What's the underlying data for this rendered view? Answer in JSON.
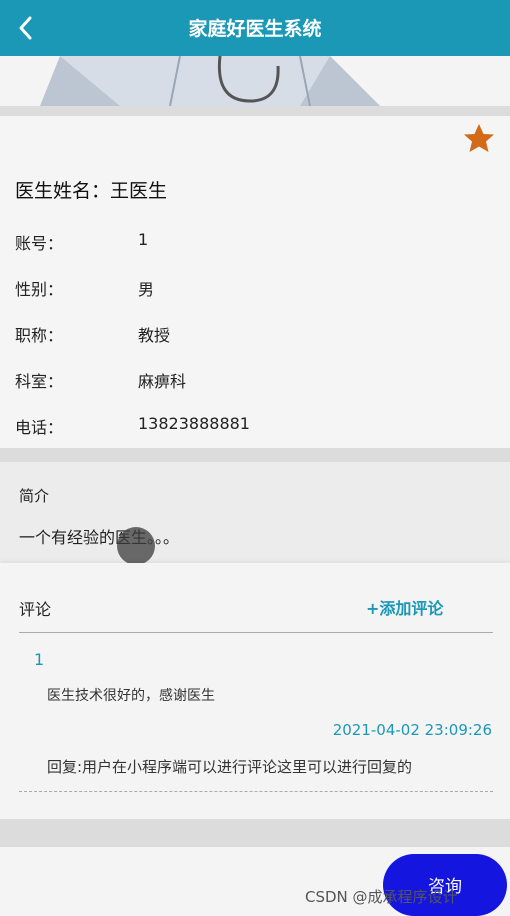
{
  "header": {
    "title": "家庭好医生系统"
  },
  "doctor": {
    "name_label": "医生姓名：",
    "name": "王医生",
    "fields": [
      {
        "label": "账号：",
        "value": "1"
      },
      {
        "label": "性别：",
        "value": "男"
      },
      {
        "label": "职称：",
        "value": "教授"
      },
      {
        "label": "科室：",
        "value": "麻痹科"
      },
      {
        "label": "电话：",
        "value": "13823888881"
      }
    ]
  },
  "intro": {
    "title": "简介",
    "text": "一个有经验的医生。。。"
  },
  "comments": {
    "title": "评论",
    "add_label": "+添加评论",
    "items": [
      {
        "user": "1",
        "text": "医生技术很好的，感谢医生",
        "time": "2021-04-02 23:09:26",
        "reply": "回复:用户在小程序端可以进行评论这里可以进行回复的"
      }
    ]
  },
  "bottom": {
    "consult_label": "咨询"
  },
  "watermark": "CSDN @成承程序设计",
  "colors": {
    "primary": "#1b98b6",
    "star": "#d26a1a",
    "consult_button": "#1515e0"
  }
}
